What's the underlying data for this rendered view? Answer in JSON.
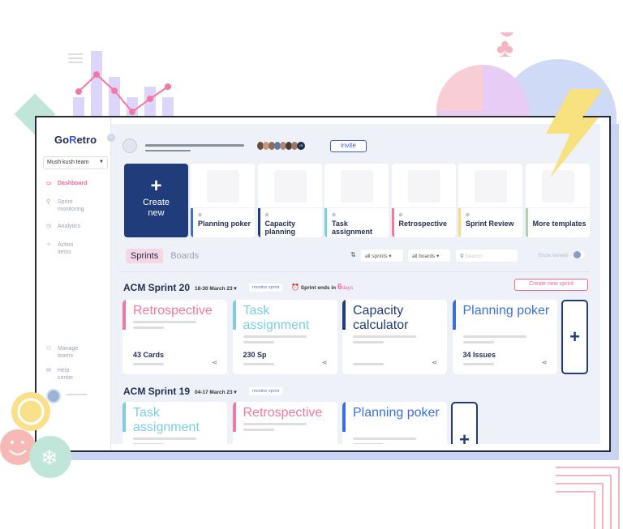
{
  "app": {
    "logo": "GoRetro",
    "team": "Mush kush team"
  },
  "sidebar": {
    "items": [
      {
        "label": "Dashboard",
        "icon": "dashboard-icon",
        "active": true
      },
      {
        "label": "Sprint monitoring",
        "icon": "monitor-icon"
      },
      {
        "label": "Analytics",
        "icon": "clock-icon"
      },
      {
        "label": "Action items",
        "icon": "action-icon"
      }
    ],
    "bottom": [
      {
        "label": "Manage teams",
        "icon": "teams-icon"
      },
      {
        "label": "Help center",
        "icon": "help-icon"
      }
    ]
  },
  "header": {
    "avatars_more": "+5",
    "invite": "invite"
  },
  "templates": {
    "create": "Create new",
    "items": [
      {
        "label": "Planning poker",
        "color": "#3b6fe0"
      },
      {
        "label": "Capacity planning",
        "color": "#203c7a"
      },
      {
        "label": "Task assignment",
        "color": "#7ccfe0"
      },
      {
        "label": "Retrospective",
        "color": "#f4779f"
      },
      {
        "label": "Sprint Review",
        "color": "#f6dc7c"
      },
      {
        "label": "More templates",
        "color": "#a9d5a8"
      }
    ]
  },
  "tabs": [
    "Sprints",
    "Boards"
  ],
  "filters": {
    "sprints": "all sprints",
    "boards": "all boards",
    "search_placeholder": "Search",
    "show_locked": "Show locked"
  },
  "sprints": [
    {
      "name": "ACM Sprint 20",
      "dates": "18-30 March 23",
      "monitor": "monitor sprint",
      "ends_label": "Sprint ends in",
      "ends_num": "6",
      "ends_unit": "days",
      "create_btn": "Create new sprint",
      "cards": [
        {
          "title": "Retrospective",
          "count": "43 Cards",
          "color": "#f4779f"
        },
        {
          "title": "Task assignment",
          "count": "230 Sp",
          "color": "#7ccfe0"
        },
        {
          "title": "Capacity calculator",
          "count": "",
          "color": "#203c7a"
        },
        {
          "title": "Planning poker",
          "count": "34 Issues",
          "color": "#3b6fe0"
        }
      ]
    },
    {
      "name": "ACM Sprint 19",
      "dates": "04-17 March 23",
      "monitor": "monitor sprint",
      "cards": [
        {
          "title": "Task assignment",
          "color": "#7ccfe0"
        },
        {
          "title": "Retrospective",
          "color": "#f4779f"
        },
        {
          "title": "Planning poker",
          "color": "#3b6fe0"
        }
      ]
    }
  ]
}
